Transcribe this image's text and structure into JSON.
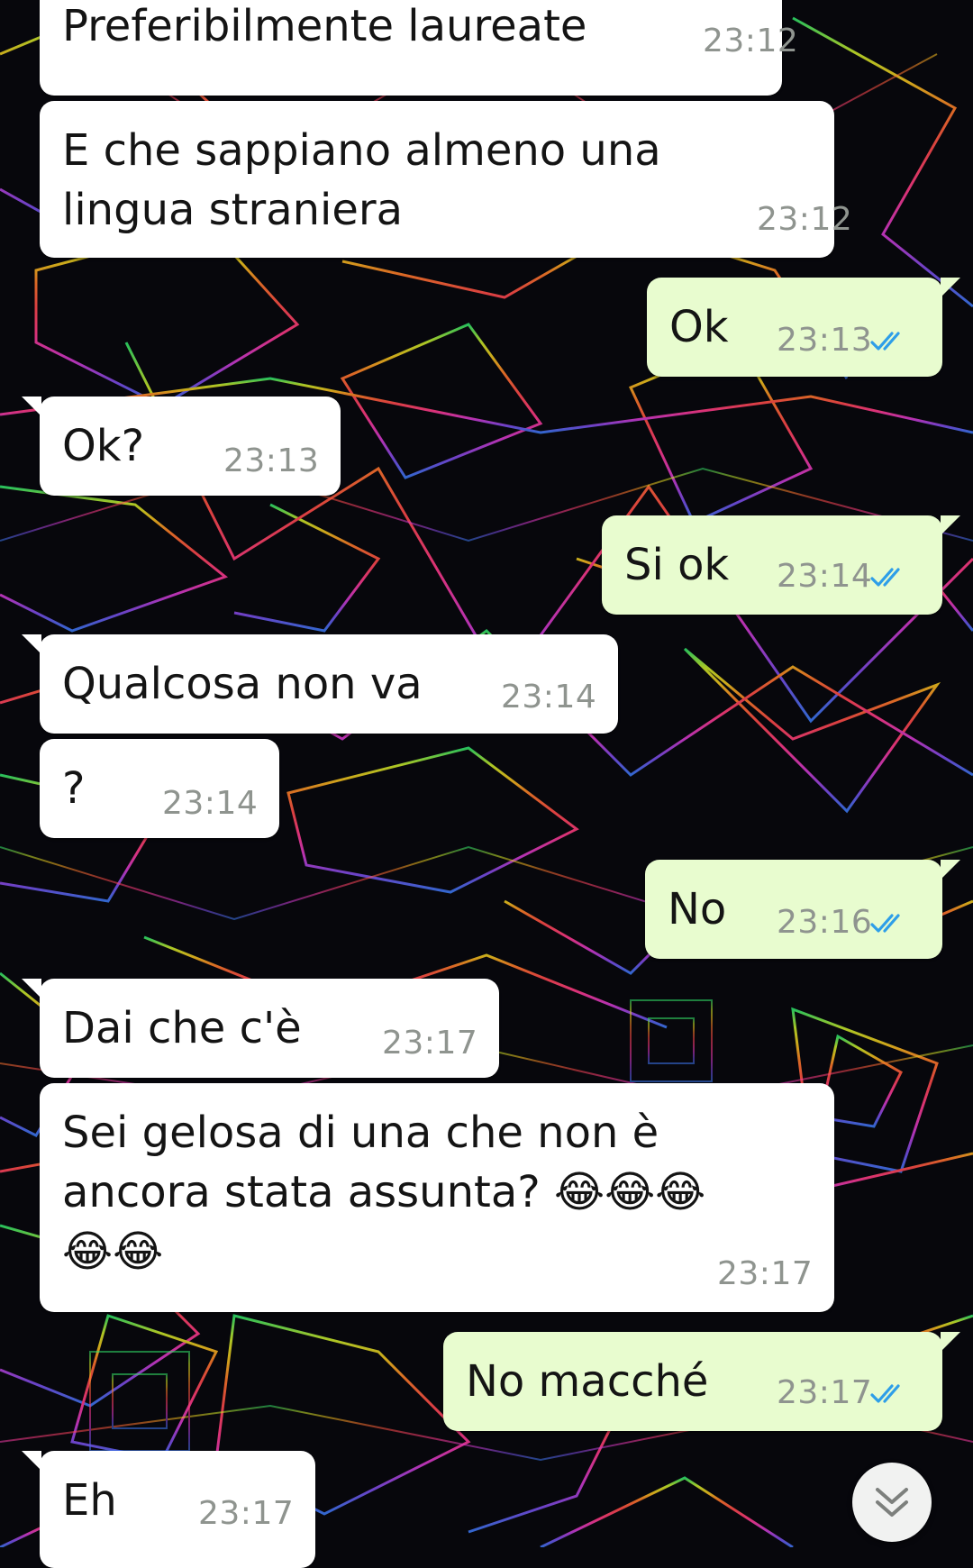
{
  "chat": {
    "messages": [
      {
        "direction": "in",
        "text": "Preferibilmente laureate",
        "time": "23:12"
      },
      {
        "direction": "in",
        "text": "E che sappiano almeno una\nlingua straniera",
        "time": "23:12"
      },
      {
        "direction": "out",
        "text": "Ok",
        "time": "23:13",
        "status": "read"
      },
      {
        "direction": "in",
        "text": "Ok?",
        "time": "23:13"
      },
      {
        "direction": "out",
        "text": "Si ok",
        "time": "23:14",
        "status": "read"
      },
      {
        "direction": "in",
        "text": "Qualcosa non va",
        "time": "23:14"
      },
      {
        "direction": "in",
        "text": "?",
        "time": "23:14"
      },
      {
        "direction": "out",
        "text": "No",
        "time": "23:16",
        "status": "read"
      },
      {
        "direction": "in",
        "text": "Dai che c'è",
        "time": "23:17"
      },
      {
        "direction": "in",
        "text": "Sei gelosa di una che non è\nancora stata assunta? 😂😂😂\n😂😂",
        "time": "23:17"
      },
      {
        "direction": "out",
        "text": "No macché",
        "time": "23:17",
        "status": "read"
      },
      {
        "direction": "in",
        "text": "Eh",
        "time": "23:17"
      }
    ]
  },
  "colors": {
    "incoming_bubble": "#ffffff",
    "outgoing_bubble": "#e8fccf",
    "read_ticks": "#2e9ee8",
    "timestamp": "#8f948f"
  },
  "icons": {
    "read_receipt": "double-check-icon",
    "scroll_down": "double-chevron-down-icon"
  }
}
